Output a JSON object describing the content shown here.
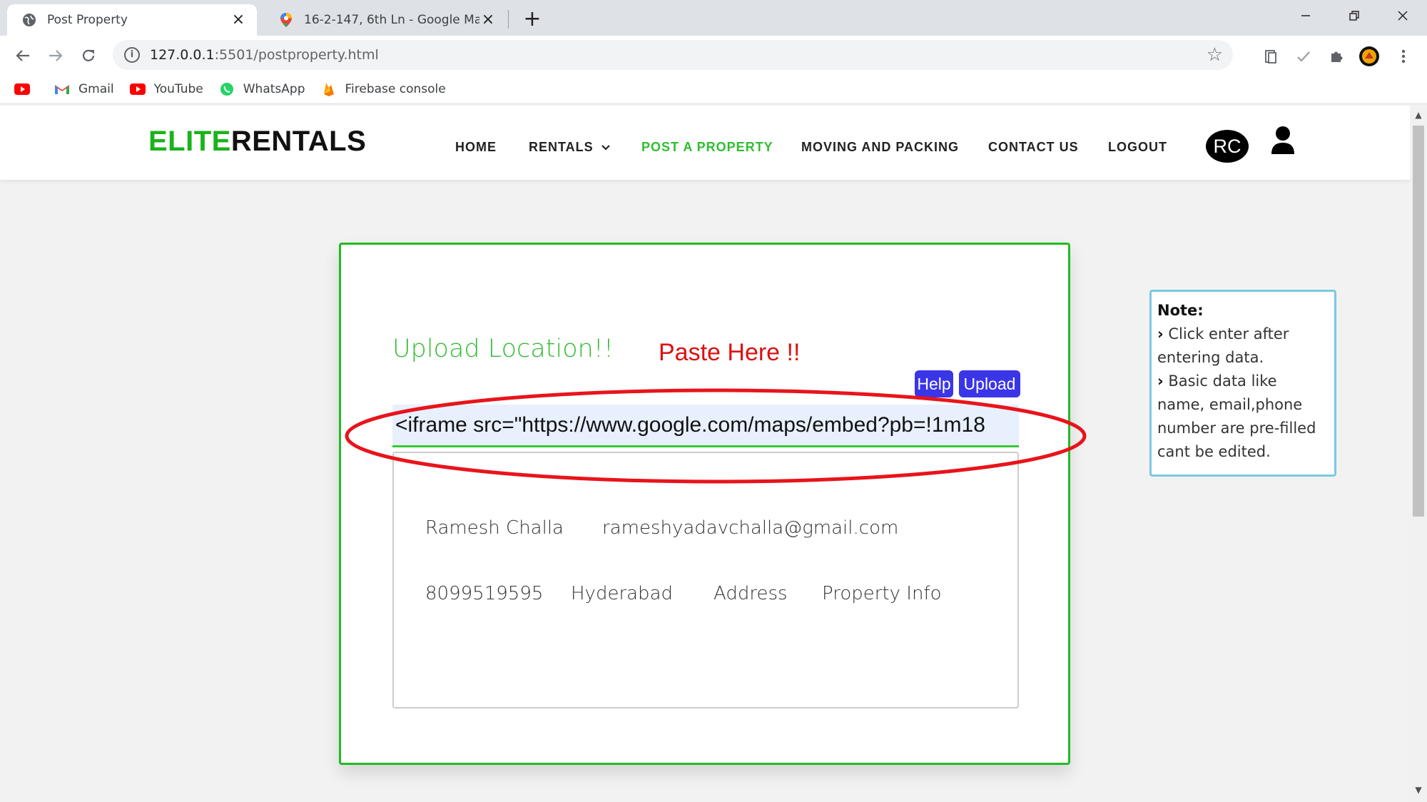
{
  "browser": {
    "tabs": [
      {
        "title": "Post Property",
        "active": true
      },
      {
        "title": "16-2-147, 6th Ln - Google Maps",
        "active": false
      }
    ],
    "url_host": "127.0.0.1",
    "url_rest": ":5501/postproperty.html",
    "bookmarks": [
      {
        "label": "",
        "icon": "youtube-icon"
      },
      {
        "label": "Gmail",
        "icon": "gmail-icon"
      },
      {
        "label": "YouTube",
        "icon": "youtube-icon"
      },
      {
        "label": "WhatsApp",
        "icon": "whatsapp-icon"
      },
      {
        "label": "Firebase console",
        "icon": "firebase-icon"
      }
    ]
  },
  "site": {
    "logo_part1": "ELITE",
    "logo_part2": "RENTALS",
    "nav": {
      "home": "HOME",
      "rentals": "RENTALS",
      "post": "POST A PROPERTY",
      "moving": "MOVING AND PACKING",
      "contact": "CONTACT US",
      "logout": "LOGOUT"
    },
    "avatar_initials": "RC"
  },
  "form": {
    "title": "Upload Location!!",
    "paste_note": "Paste Here !!",
    "help_label": "Help",
    "upload_label": "Upload",
    "iframe_value": "<iframe src=\"https://www.google.com/maps/embed?pb=!1m18",
    "name": "Ramesh Challa",
    "email": "rameshyadavchalla@gmail.com",
    "phone": "8099519595",
    "city": "Hyderabad",
    "address": "Address",
    "property_info": "Property Info"
  },
  "note": {
    "title": "Note:",
    "line1": "Click enter after entering data.",
    "line2": "Basic data like name, email,phone number are pre-filled cant be edited."
  },
  "colors": {
    "brand_green": "#1bb31b",
    "button_blue": "#3b35e8",
    "annotation_red": "#dd1111",
    "note_border": "#7cc7e0"
  }
}
